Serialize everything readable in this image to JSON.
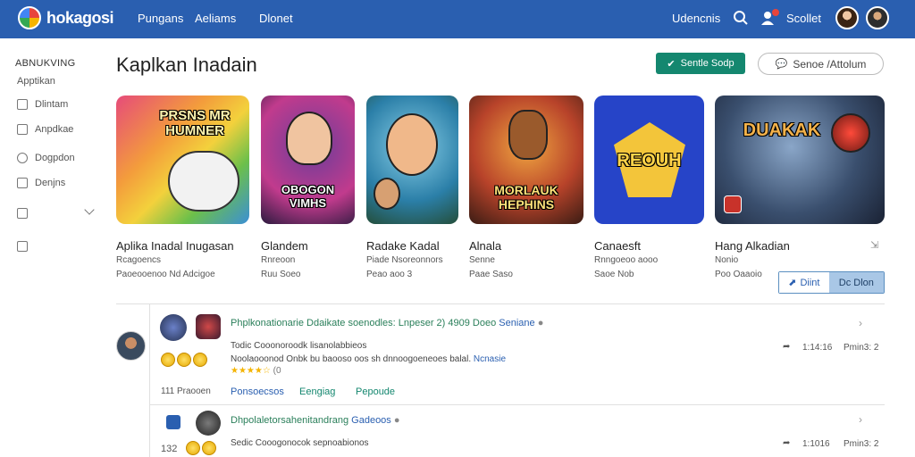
{
  "topbar": {
    "brand": "hokagosi",
    "nav": [
      "Pungans",
      "Aeliams",
      "Dlonet"
    ],
    "right_text": "Udencnis",
    "user_label": "Scollet",
    "icons": [
      "search-icon",
      "user-icon"
    ]
  },
  "sidebar": {
    "heading": "ABNUKVING",
    "subheading": "Apptikan",
    "items": [
      {
        "label": "Dlintam",
        "icon": "square-icon"
      },
      {
        "label": "Anpdkae",
        "icon": "check-icon"
      },
      {
        "label": "Dogpdon",
        "icon": "circle-icon"
      },
      {
        "label": "Denjns",
        "icon": "grid-icon"
      },
      {
        "label": "",
        "icon": "bookmark-icon"
      },
      {
        "label": "",
        "icon": "box-icon"
      }
    ]
  },
  "main": {
    "title": "Kaplkan Inadain",
    "primary_button": "Sentle Sodp",
    "secondary_button": "Senoe /Attolum",
    "cards": [
      {
        "art": "PRSNS MR HUMNER",
        "title": "Aplika Inadal Inugasan",
        "line1": "Rcagoencs",
        "line2": "Paoeooenoo Nd Adcigoe"
      },
      {
        "art": "OBOGON VIMHS",
        "title": "Glandem",
        "line1": "Rnreoon",
        "line2": "Ruu Soeo"
      },
      {
        "art": "",
        "title": "Radake Kadal",
        "line1": "Piade Nsoreonnors",
        "line2": "Peao aoo 3"
      },
      {
        "art": "MORLAUK HEPHINS",
        "title": "Alnala",
        "line1": "Senne",
        "line2": "Paae Saso"
      },
      {
        "art": "REOUH",
        "title": "Canaesft",
        "line1": "Rnngoeoo aooo",
        "line2": "Saoe Nob"
      },
      {
        "art": "DUAKAK",
        "title": "Hang Alkadian",
        "line1": "Nonio",
        "line2": "Poo Oaaoio"
      }
    ],
    "split_button": {
      "left": "Diint",
      "right": "Dc Dlon"
    }
  },
  "feed": [
    {
      "title": "Phplkonationarie Ddaikate soenodles: Lnpeser 2) 4909 Doeo ",
      "title_link": "Seniane",
      "line1": "Todic Cooonoroodk lisanolabbieos",
      "line2": "Noolaooonod Onbk bu baooso oos sh dnnoogoeneoes balal.",
      "line2_link": "Ncnasie",
      "rating": "★★★★☆",
      "rating_count": "(0",
      "footer_left": "111 Praooen",
      "actions": [
        "Ponsoecsos",
        "Eengiag",
        "Pepoude"
      ],
      "meta1": "1:14:16",
      "meta2": "Pmin3: 2"
    },
    {
      "title": "Dhpolaletorsahenitandrang ",
      "title_link": "Gadeoos",
      "line1": "Sedic Cooogonocok sepnoabionos",
      "line2": "",
      "line2_link": "",
      "rating": "",
      "rating_count": "",
      "footer_left": "132",
      "actions": [],
      "meta1": "1:1016",
      "meta2": "Pmin3: 2"
    }
  ],
  "colors": {
    "topbar": "#2a5fb0",
    "accent_green": "#14876f",
    "link": "#2a5fb0"
  }
}
